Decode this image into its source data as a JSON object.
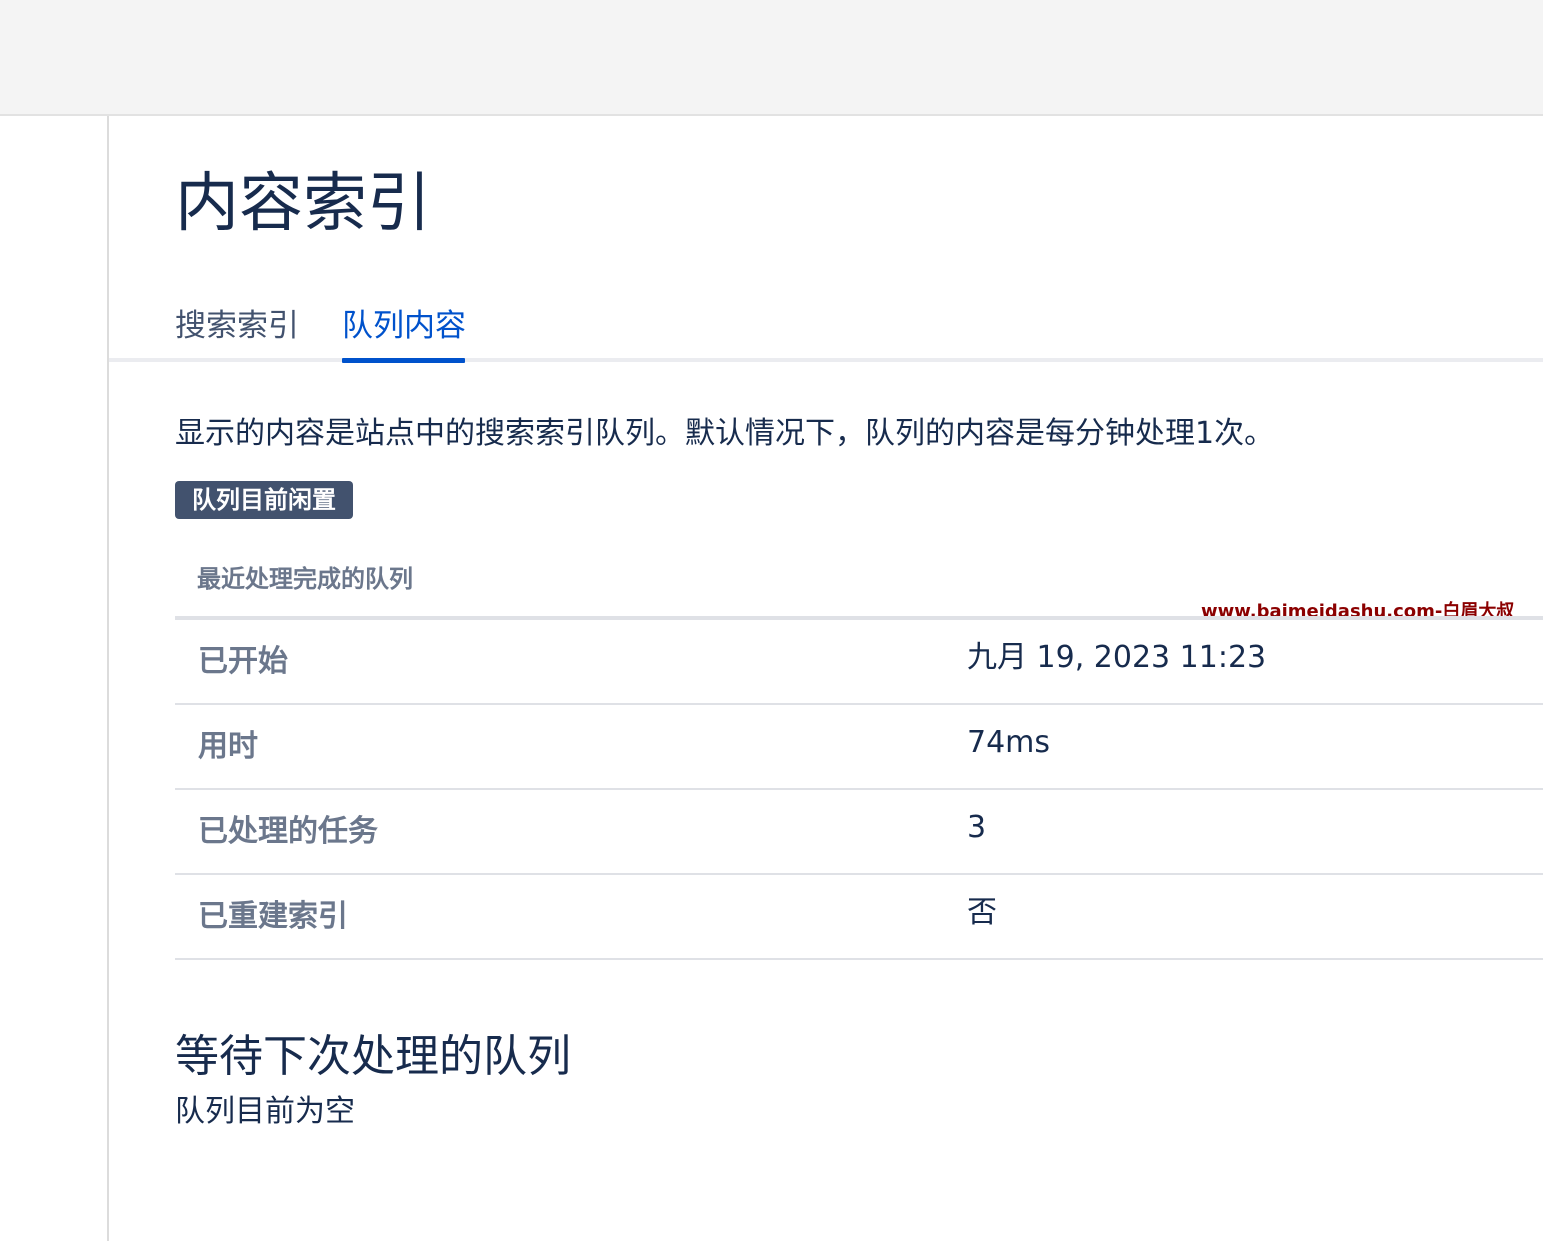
{
  "page": {
    "title": "内容索引"
  },
  "tabs": [
    {
      "label": "搜索索引",
      "active": false
    },
    {
      "label": "队列内容",
      "active": true
    }
  ],
  "description": "显示的内容是站点中的搜索索引队列。默认情况下，队列的内容是每分钟处理1次。",
  "status_badge": "队列目前闲置",
  "last_processed": {
    "heading": "最近处理完成的队列",
    "rows": [
      {
        "label": "已开始",
        "value": "九月 19, 2023 11:23"
      },
      {
        "label": "用时",
        "value": "74ms"
      },
      {
        "label": "已处理的任务",
        "value": "3"
      },
      {
        "label": "已重建索引",
        "value": "否"
      }
    ]
  },
  "pending": {
    "heading": "等待下次处理的队列",
    "text": "队列目前为空"
  },
  "watermark": "www.baimeidashu.com-白眉大叔",
  "colors": {
    "accent": "#0052cc",
    "heading_text": "#172b4d",
    "muted_text": "#6b778c",
    "badge_bg": "#42526e",
    "watermark": "#8b0000"
  }
}
